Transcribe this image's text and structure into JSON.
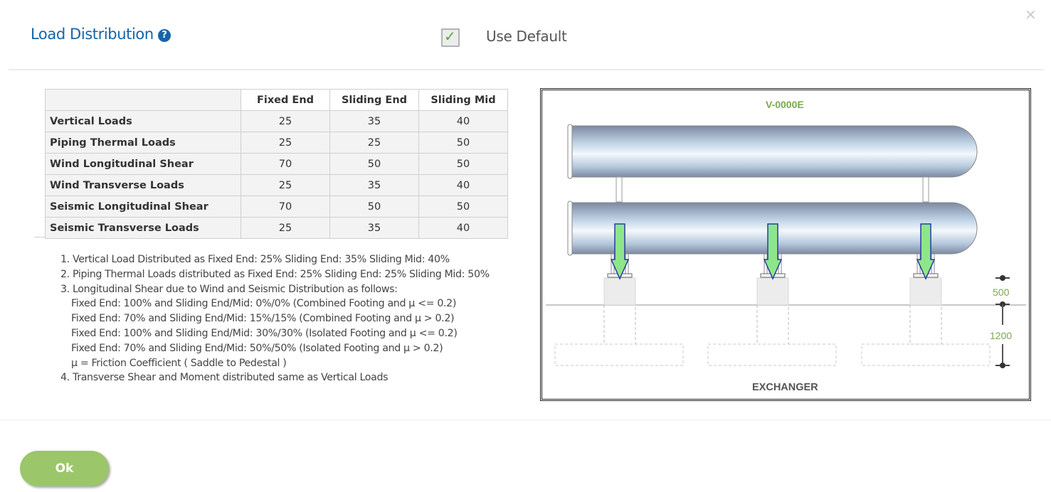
{
  "header": {
    "title": "Load Distribution",
    "help_icon": "question-circle-icon",
    "use_default": {
      "label": "Use Default",
      "checked": true,
      "check_glyph": "✓"
    },
    "close_glyph": "×"
  },
  "table": {
    "columns": [
      "",
      "Fixed End",
      "Sliding End",
      "Sliding Mid"
    ],
    "rows": [
      {
        "label": "Vertical Loads",
        "values": [
          "25",
          "35",
          "40"
        ]
      },
      {
        "label": "Piping Thermal Loads",
        "values": [
          "25",
          "25",
          "50"
        ]
      },
      {
        "label": "Wind Longitudinal Shear",
        "values": [
          "70",
          "50",
          "50"
        ]
      },
      {
        "label": "Wind Transverse Loads",
        "values": [
          "25",
          "35",
          "40"
        ]
      },
      {
        "label": "Seismic Longitudinal Shear",
        "values": [
          "70",
          "50",
          "50"
        ]
      },
      {
        "label": "Seismic Transverse Loads",
        "values": [
          "25",
          "35",
          "40"
        ]
      }
    ]
  },
  "notes": [
    "1. Vertical Load Distributed as Fixed End: 25% Sliding End: 35% Sliding Mid: 40%",
    "2. Piping Thermal Loads distributed as Fixed End: 25% Sliding End: 25% Sliding Mid: 50%",
    "3. Longitudinal Shear due to Wind and Seismic Distribution as follows:",
    "Fixed End: 100% and Sliding End/Mid: 0%/0% (Combined Footing and μ <= 0.2)",
    "Fixed End: 70% and Sliding End/Mid: 15%/15% (Combined Footing and μ > 0.2)",
    "Fixed End: 100% and Sliding End/Mid: 30%/30% (Isolated Footing and μ <= 0.2)",
    "Fixed End: 70% and Sliding End/Mid: 50%/50% (Isolated Footing and μ > 0.2)",
    "μ = Friction Coefficient ( Saddle to Pedestal )",
    "4. Transverse Shear and Moment distributed same as Vertical Loads"
  ],
  "diagram": {
    "tag": "V-0000E",
    "type_label": "EXCHANGER",
    "dim_pedestal": "500",
    "dim_footing": "1200",
    "colors": {
      "tag": "#7aa94f",
      "dims": "#7aa94f",
      "arrow_fill": "#8ee68a",
      "arrow_stroke": "#2a3aa0"
    }
  },
  "footer": {
    "ok_label": "Ok"
  }
}
